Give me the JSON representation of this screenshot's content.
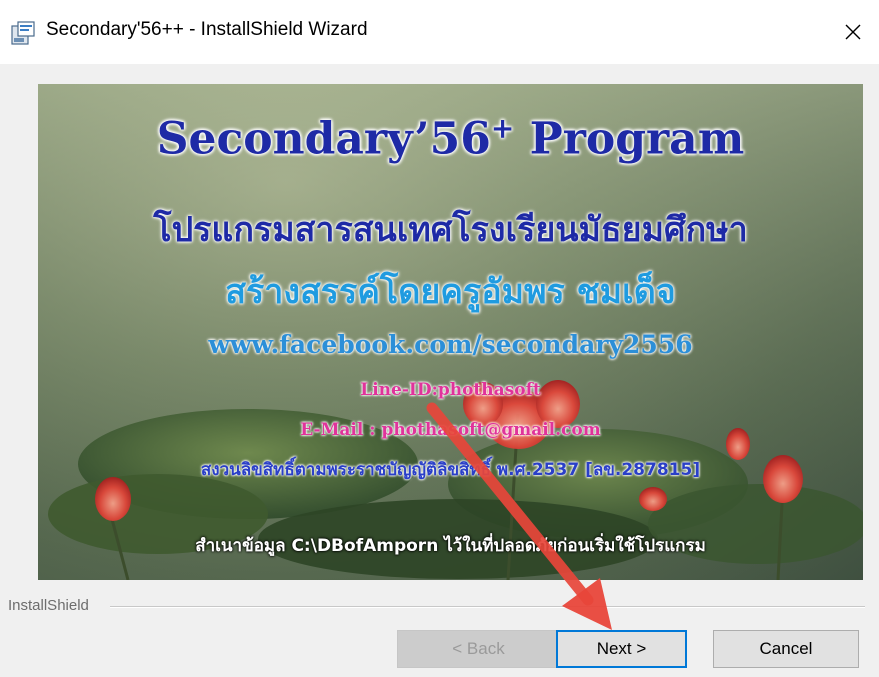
{
  "window": {
    "title": "Secondary'56++ - InstallShield Wizard",
    "close_glyph": "✕",
    "app_icon": "installer-icon"
  },
  "banner": {
    "title_main": "Secondary’56",
    "title_sup": "+",
    "title_tail": " Program",
    "thai_line1": "โปรแกรมสารสนเทศโรงเรียนมัธยมศึกษา",
    "thai_line2": "สร้างสรรค์โดยครูอัมพร  ชมเด็จ",
    "website": "www.facebook.com/secondary2556",
    "line_id": "Line-ID:phothasoft",
    "email": "E-Mail : phothasoft@gmail.com",
    "copyright": "สงวนลิขสิทธิ์ตามพระราชบัญญัติลิขสิทธิ์ พ.ศ.2537 [ลข.287815]",
    "note": "สำเนาข้อมูล C:\\DBofAmporn ไว้ในที่ปลอดภัยก่อนเริ่มใช้โปรแกรม"
  },
  "footer": {
    "group_label": "InstallShield",
    "back_label": "< Back",
    "next_label": "Next >",
    "cancel_label": "Cancel"
  },
  "colors": {
    "arrow": "#e8463a",
    "focus_border": "#0078d7"
  }
}
